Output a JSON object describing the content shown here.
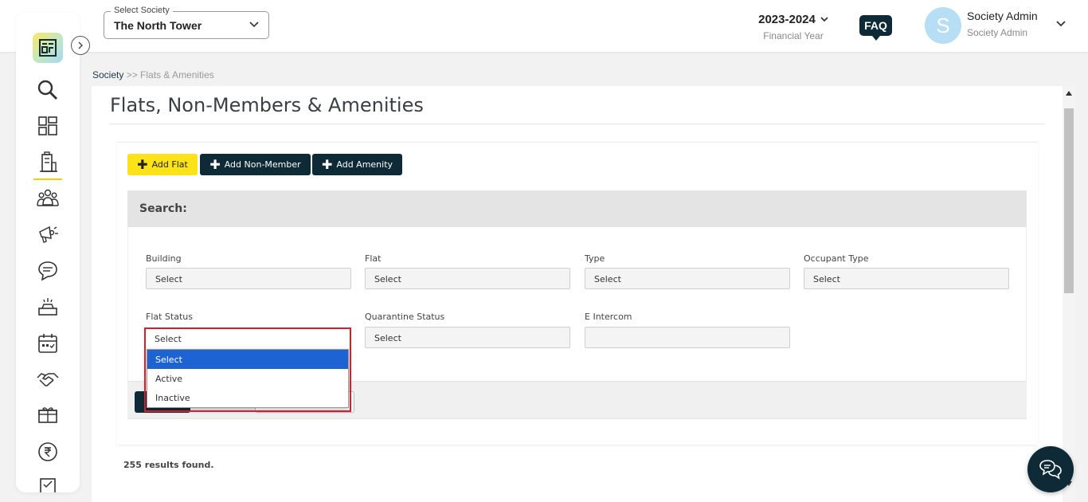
{
  "header": {
    "society_label": "Select Society",
    "society_value": "The North Tower",
    "fy_year": "2023-2024",
    "fy_label": "Financial Year",
    "faq_label": "FAQ",
    "avatar_letter": "S",
    "user_name": "Society Admin",
    "user_role": "Society Admin"
  },
  "breadcrumb": {
    "root": "Society",
    "sep": " >> ",
    "current": "Flats & Amenities"
  },
  "page": {
    "title": "Flats, Non-Members & Amenities"
  },
  "buttons": {
    "add_flat": "Add Flat",
    "add_non_member": "Add Non-Member",
    "add_amenity": "Add Amenity",
    "plus": "✚"
  },
  "search": {
    "heading": "Search:",
    "fields": [
      {
        "label": "Building",
        "value": "Select"
      },
      {
        "label": "Flat",
        "value": "Select"
      },
      {
        "label": "Type",
        "value": "Select"
      },
      {
        "label": "Occupant Type",
        "value": "Select"
      },
      {
        "label": "Flat Status",
        "value": "Select"
      },
      {
        "label": "Quarantine Status",
        "value": "Select"
      },
      {
        "label": "E Intercom",
        "value": ""
      }
    ]
  },
  "dropdown": {
    "options": [
      "Select",
      "Active",
      "Inactive"
    ],
    "selected": "Select"
  },
  "results": {
    "count_text": "255 results found."
  },
  "colors": {
    "accent_yellow": "#fbe219",
    "dark_navy": "#0d2a36",
    "highlight_red": "#d4202a",
    "selected_blue": "#1e63d3"
  },
  "icons": [
    "search-icon",
    "dashboard-icon",
    "building-icon",
    "members-icon",
    "announcement-icon",
    "chat-icon",
    "amenity-icon",
    "calendar-icon",
    "handshake-icon",
    "package-icon",
    "rupee-icon",
    "document-icon"
  ]
}
